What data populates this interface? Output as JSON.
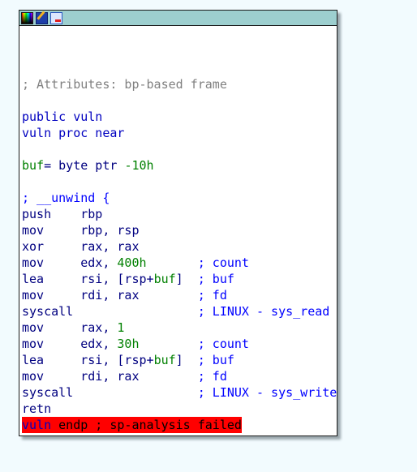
{
  "window": {
    "icons": [
      "color-palette-icon",
      "edit-node-icon",
      "graph-overview-icon"
    ]
  },
  "colors": {
    "title_bar": "#9dcfcf",
    "highlight": "#ff0000",
    "number": "#008000",
    "comment": "#0000ff"
  },
  "lines": [
    [],
    [
      {
        "t": "; Attributes: bp-based frame",
        "c": "gray"
      }
    ],
    [],
    [
      {
        "t": "public vuln",
        "c": "kw"
      }
    ],
    [
      {
        "t": "vuln proc near",
        "c": "kw"
      }
    ],
    [],
    [
      {
        "t": "buf",
        "c": "num"
      },
      {
        "t": "= byte ptr ",
        "c": "ins"
      },
      {
        "t": "-10h",
        "c": "num"
      }
    ],
    [],
    [
      {
        "t": "; __unwind {",
        "c": "cmt"
      }
    ],
    [
      {
        "t": "push    rbp",
        "c": "ins"
      }
    ],
    [
      {
        "t": "mov     rbp, rsp",
        "c": "ins"
      }
    ],
    [
      {
        "t": "xor     rax, rax",
        "c": "ins"
      }
    ],
    [
      {
        "t": "mov     edx, ",
        "c": "ins"
      },
      {
        "t": "400h",
        "c": "num"
      },
      {
        "t": "       ; count",
        "c": "cmt"
      }
    ],
    [
      {
        "t": "lea     rsi, [rsp+",
        "c": "ins"
      },
      {
        "t": "buf",
        "c": "num"
      },
      {
        "t": "]",
        "c": "ins"
      },
      {
        "t": "  ; buf",
        "c": "cmt"
      }
    ],
    [
      {
        "t": "mov     rdi, rax",
        "c": "ins"
      },
      {
        "t": "        ; fd",
        "c": "cmt"
      }
    ],
    [
      {
        "t": "syscall",
        "c": "ins"
      },
      {
        "t": "                 ; LINUX - sys_read",
        "c": "cmt"
      }
    ],
    [
      {
        "t": "mov     rax, ",
        "c": "ins"
      },
      {
        "t": "1",
        "c": "num"
      }
    ],
    [
      {
        "t": "mov     edx, ",
        "c": "ins"
      },
      {
        "t": "30h",
        "c": "num"
      },
      {
        "t": "        ; count",
        "c": "cmt"
      }
    ],
    [
      {
        "t": "lea     rsi, [rsp+",
        "c": "ins"
      },
      {
        "t": "buf",
        "c": "num"
      },
      {
        "t": "]",
        "c": "ins"
      },
      {
        "t": "  ; buf",
        "c": "cmt"
      }
    ],
    [
      {
        "t": "mov     rdi, rax",
        "c": "ins"
      },
      {
        "t": "        ; fd",
        "c": "cmt"
      }
    ],
    [
      {
        "t": "syscall",
        "c": "ins"
      },
      {
        "t": "                 ; LINUX - sys_write",
        "c": "cmt"
      }
    ],
    [
      {
        "t": "retn",
        "c": "ins"
      }
    ],
    [
      {
        "t": "vuln",
        "c": "kw",
        "hl": true
      },
      {
        "t": " endp ; sp-analysis failed",
        "c": "blk",
        "hl": true
      }
    ]
  ]
}
